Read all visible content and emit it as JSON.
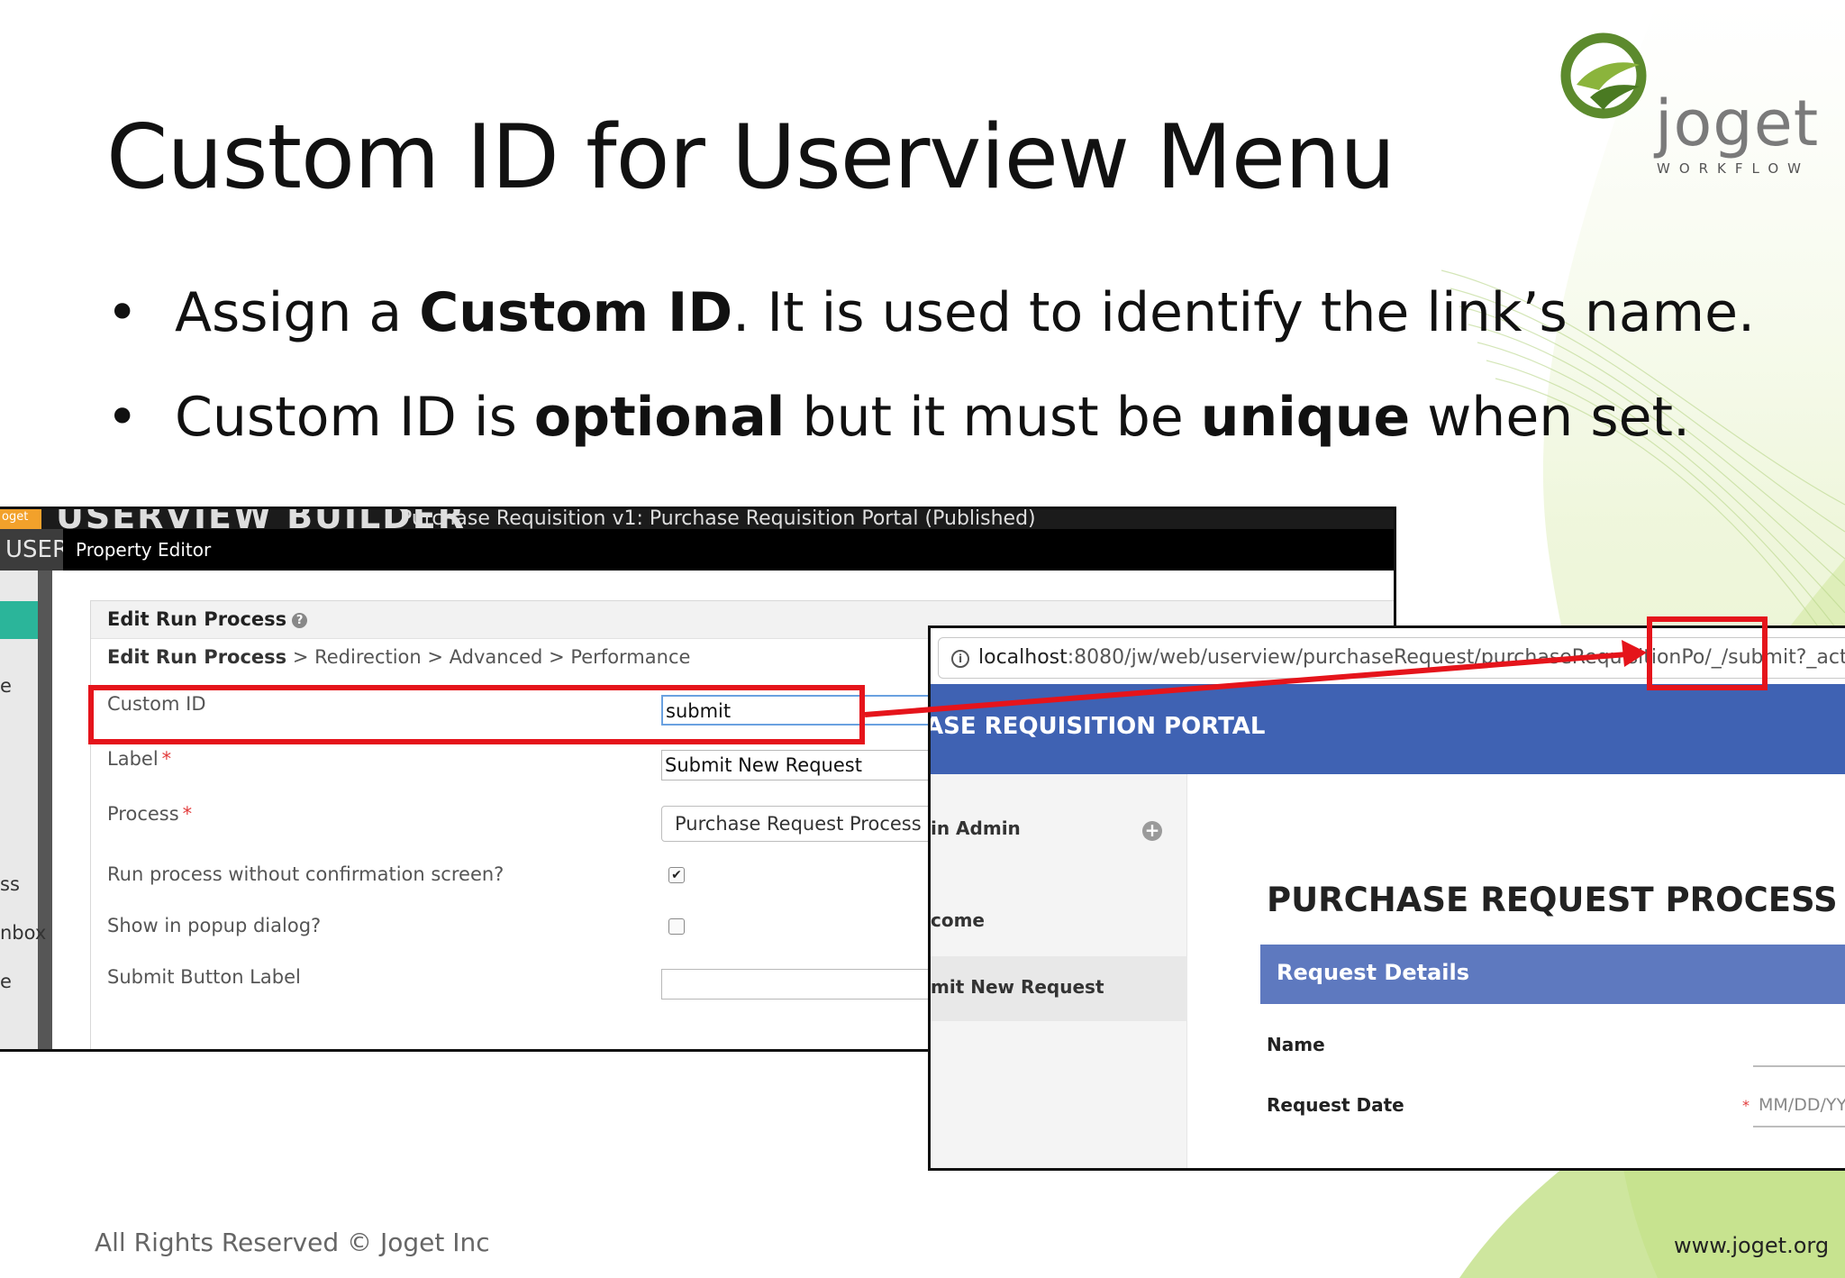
{
  "slide": {
    "title": "Custom ID for Userview Menu",
    "bullet1": {
      "pre": "Assign a ",
      "bold": "Custom ID",
      "post": ". It is used to identify the link’s name."
    },
    "bullet2": {
      "pre": "Custom ID is ",
      "bold1": "optional",
      "mid": " but it must be ",
      "bold2": "unique",
      "post": " when set."
    },
    "footer": "All Rights Reserved © Joget Inc",
    "footer_url": "www.joget.org"
  },
  "logo": {
    "wordmark": "joget",
    "tagline": "WORKFLOW"
  },
  "left_shot": {
    "logo_text": "oget",
    "builder_title": "USERVIEW BUILDER",
    "builder_subtitle": "Purchase Requisition v1: Purchase Requisition Portal (Published)",
    "use_tab": "USER",
    "property_editor": "Property Editor",
    "strip_items": [
      "e",
      "ss",
      "nbox",
      "e"
    ],
    "panel_title": "Edit Run Process",
    "help_icon": "?",
    "breadcrumb": {
      "current": "Edit Run Process",
      "rest": " > Redirection > Advanced > Performance"
    },
    "fields": {
      "custom_id_label": "Custom ID",
      "custom_id_value": "submit",
      "label_label": "Label",
      "label_value": "Submit New Request",
      "process_label": "Process",
      "process_value": "Purchase Request Process (",
      "run_without_confirm_label": "Run process without confirmation screen?",
      "run_without_confirm_checked": true,
      "popup_label": "Show in popup dialog?",
      "popup_checked": false,
      "submit_label_label": "Submit Button Label",
      "submit_label_value": "",
      "required_mark": "*",
      "check_mark": "✔"
    }
  },
  "right_shot": {
    "info_icon": "i",
    "url_host": "localhost",
    "url_rest": ":8080/jw/web/userview/purchaseRequest/purchaseRequisitionPo",
    "url_highlight": "/_/submit?_action=ass",
    "portal_title": "ASE REQUISITION PORTAL",
    "side_user": "in Admin",
    "plus_icon": "+",
    "side_welcome": "come",
    "side_active": "mit New Request",
    "form_title": "PURCHASE REQUEST PROCESS - S",
    "section_title": "Request Details",
    "name_label": "Name",
    "date_label": "Request Date",
    "date_placeholder": "MM/DD/YY",
    "required_mark": "*"
  },
  "colors": {
    "highlight_red": "#e5141b",
    "userview_blue": "#3f62b3",
    "section_blue": "#5e79bf",
    "accent_green": "#2bb59a",
    "logo_green": "#5c8a2d"
  }
}
